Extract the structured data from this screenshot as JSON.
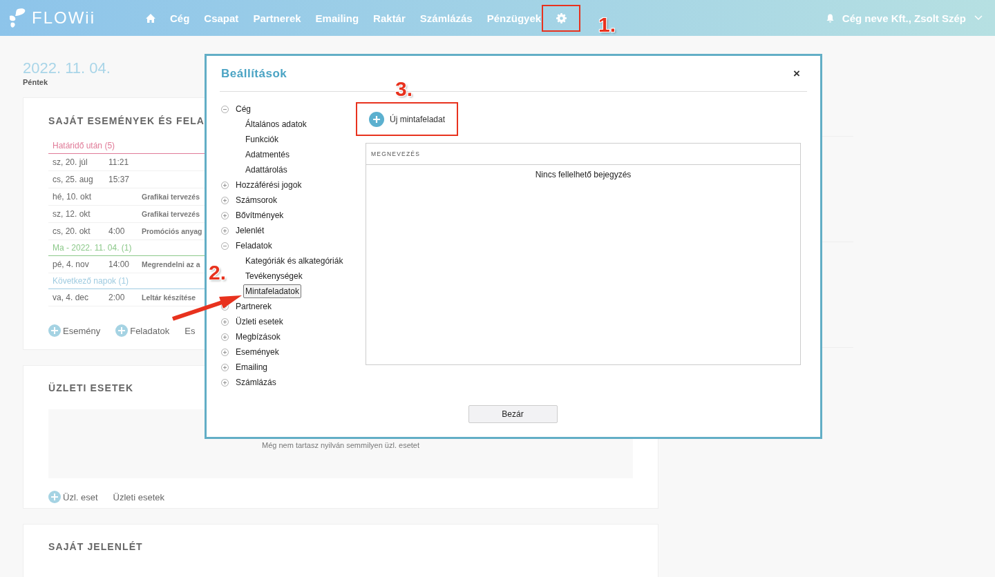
{
  "header": {
    "logo": "FLOWii",
    "nav": [
      {
        "kind": "home"
      },
      {
        "kind": "text",
        "label": "Cég"
      },
      {
        "kind": "text",
        "label": "Csapat"
      },
      {
        "kind": "text",
        "label": "Partnerek"
      },
      {
        "kind": "text",
        "label": "Emailing"
      },
      {
        "kind": "text",
        "label": "Raktár"
      },
      {
        "kind": "text",
        "label": "Számlázás"
      },
      {
        "kind": "text",
        "label": "Pénzügyek"
      },
      {
        "kind": "settings",
        "highlighted": true
      }
    ],
    "user": "Cég neve Kft., Zsolt Szép"
  },
  "date": {
    "value": "2022. 11. 04.",
    "weekday": "Péntek"
  },
  "events_card": {
    "title": "SAJÁT ESEMÉNYEK ÉS FELA",
    "sections": [
      {
        "label": "Határidő után (5)",
        "color": "#e07b98",
        "rows": [
          {
            "date": "sz, 20. júl",
            "time": "11:21"
          },
          {
            "date": "cs, 25. aug",
            "time": "15:37"
          },
          {
            "date": "hé, 10. okt",
            "title": "Grafikai tervezés"
          },
          {
            "date": "sz, 12. okt",
            "title": "Grafikai tervezés"
          },
          {
            "date": "cs, 20. okt",
            "time": "4:00",
            "title": "Promóciós anyag"
          }
        ]
      },
      {
        "label": "Ma - 2022. 11. 04. (1)",
        "color": "#8cc98a",
        "rows": [
          {
            "date": "pé, 4. nov",
            "time": "14:00",
            "title": "Megrendelni az a"
          }
        ]
      },
      {
        "label": "Következő napok (1)",
        "color": "#9fcbe0",
        "rows": [
          {
            "date": "va, 4. dec",
            "time": "2:00",
            "title": "Leltár készítése"
          }
        ]
      }
    ],
    "actions": [
      {
        "kind": "add",
        "label": "Esemény"
      },
      {
        "kind": "add",
        "label": "Feladatok"
      },
      {
        "kind": "link",
        "label": "Es"
      }
    ]
  },
  "cases_card": {
    "title": "ÜZLETI ESETEK",
    "empty": "Még nem tartasz nyilván semmilyen üzl. esetet",
    "actions": [
      {
        "kind": "add",
        "label": "Üzl. eset"
      },
      {
        "kind": "link",
        "label": "Üzleti esetek"
      }
    ]
  },
  "attendance_card": {
    "title": "SAJÁT JELENLÉT"
  },
  "dialog": {
    "title": "Beállítások",
    "close": "×",
    "tree": [
      {
        "label": "Cég",
        "expanded": true,
        "selected": false,
        "children": [
          {
            "label": "Általános adatok",
            "selected": false
          },
          {
            "label": "Funkciók",
            "selected": false
          },
          {
            "label": "Adatmentés",
            "selected": false
          },
          {
            "label": "Adattárolás",
            "selected": false
          }
        ]
      },
      {
        "label": "Hozzáférési jogok",
        "expanded": false,
        "selected": false
      },
      {
        "label": "Számsorok",
        "expanded": false,
        "selected": false
      },
      {
        "label": "Bővítmények",
        "expanded": false,
        "selected": false
      },
      {
        "label": "Jelenlét",
        "expanded": false,
        "selected": false
      },
      {
        "label": "Feladatok",
        "expanded": true,
        "selected": false,
        "children": [
          {
            "label": "Kategóriák és alkategóriák",
            "selected": false
          },
          {
            "label": "Tevékenységek",
            "selected": false
          },
          {
            "label": "Mintafeladatok",
            "selected": true
          }
        ]
      },
      {
        "label": "Partnerek",
        "expanded": false,
        "selected": false
      },
      {
        "label": "Üzleti esetek",
        "expanded": false,
        "selected": false
      },
      {
        "label": "Megbízások",
        "expanded": false,
        "selected": false
      },
      {
        "label": "Események",
        "expanded": false,
        "selected": false
      },
      {
        "label": "Emailing",
        "expanded": false,
        "selected": false
      },
      {
        "label": "Számlázás",
        "expanded": false,
        "selected": false
      }
    ],
    "new_button": {
      "label": "Új mintafeladat",
      "highlighted": true
    },
    "table": {
      "columns": [
        "MEGNEVEZÉS"
      ],
      "empty": "Nincs fellelhető bejegyzés"
    },
    "close_button": "Bezár"
  },
  "annotations": [
    {
      "label": "1."
    },
    {
      "label": "2."
    },
    {
      "label": "3."
    }
  ]
}
